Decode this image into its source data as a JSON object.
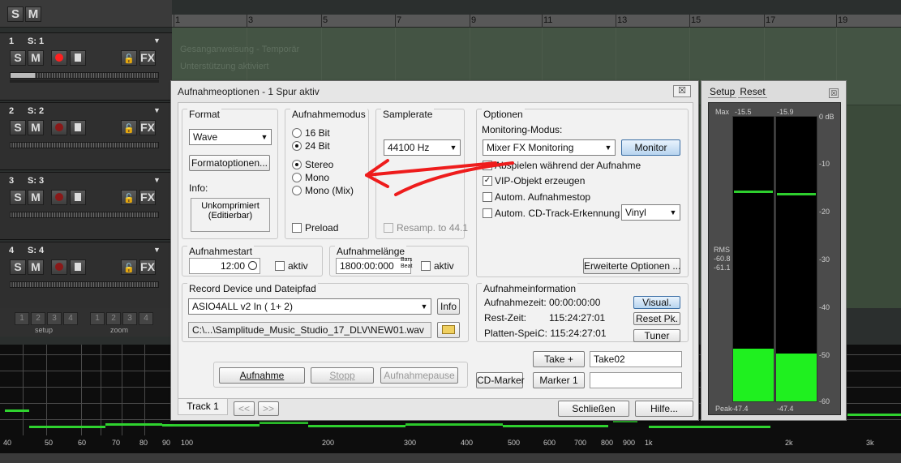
{
  "daw": {
    "top_solo": "S",
    "top_mute": "M",
    "ruler_marks": [
      "1",
      "3",
      "5",
      "7",
      "9",
      "11",
      "13",
      "15",
      "17",
      "19"
    ],
    "faded_lines": [
      "Gesanganweisung - Temporär",
      "Unterstützung aktiviert"
    ],
    "tracks": [
      {
        "num": "1",
        "name": "S: 1",
        "arm": "armed"
      },
      {
        "num": "2",
        "name": "S: 2",
        "arm": "off"
      },
      {
        "num": "3",
        "name": "S: 3",
        "arm": "off"
      },
      {
        "num": "4",
        "name": "S: 4",
        "arm": "off"
      }
    ],
    "track_buttons": {
      "solo": "S",
      "mute": "M",
      "fx": "FX"
    },
    "zoom_numbers": [
      "1",
      "2",
      "3",
      "4"
    ],
    "zoom_labels": {
      "setup": "setup",
      "zoom": "zoom"
    },
    "freq_labels": [
      "40",
      "50",
      "60",
      "70",
      "80",
      "90",
      "100",
      "200",
      "300",
      "400",
      "500",
      "600",
      "700",
      "800",
      "900",
      "1k",
      "2k",
      "3k"
    ]
  },
  "dialog": {
    "title": "Aufnahmeoptionen - 1 Spur aktiv",
    "close": "☒",
    "format": {
      "title": "Format",
      "select": "Wave",
      "options_button": "Formatoptionen...",
      "info_label": "Info:",
      "info_line1": "Unkomprimiert",
      "info_line2": "(Editierbar)"
    },
    "mode": {
      "title": "Aufnahmemodus",
      "bits": [
        "16 Bit",
        "24 Bit"
      ],
      "bits_selected": "24 Bit",
      "channels": [
        "Stereo",
        "Mono",
        "Mono (Mix)"
      ],
      "channels_selected": "Stereo",
      "preload": "Preload"
    },
    "samplerate": {
      "title": "Samplerate",
      "select": "44100 Hz",
      "resamp": "Resamp. to 44.1"
    },
    "options": {
      "title": "Optionen",
      "monitoring_label": "Monitoring-Modus:",
      "monitoring_select": "Mixer FX Monitoring",
      "monitor_button": "Monitor",
      "cb_play": "Abspielen während der Aufnahme",
      "cb_vip": "VIP-Objekt erzeugen",
      "cb_autostop": "Autom. Aufnahmestop",
      "cb_cdtrack": "Autom. CD-Track-Erkennung",
      "vinyl_select": "Vinyl",
      "advanced_button": "Erweiterte Optionen ..."
    },
    "start": {
      "title": "Aufnahmestart",
      "value": "12:00",
      "aktiv": "aktiv"
    },
    "length": {
      "title": "Aufnahmelänge",
      "value": "1800:00:000",
      "unit1": "Bars",
      "unit2": "Beat",
      "aktiv": "aktiv"
    },
    "device": {
      "title": "Record Device und Dateipfad",
      "select": "ASIO4ALL v2 In ( 1+ 2)",
      "info_button": "Info",
      "path": "C:\\...\\Samplitude_Music_Studio_17_DLV\\NEW01.wav"
    },
    "recinfo": {
      "title": "Aufnahmeinformation",
      "time_label": "Aufnahmezeit:",
      "time_value": "00:00:00:00",
      "rest_label": "Rest-Zeit:",
      "rest_value": "115:24:27:01",
      "disk_label": "Platten-Spei.",
      "disk_value": "C: 115:24:27:01",
      "visual_button": "Visual.",
      "resetpk_button": "Reset Pk.",
      "tuner_button": "Tuner"
    },
    "transport": {
      "record": "Aufnahme",
      "stop": "Stopp",
      "pause": "Aufnahmepause"
    },
    "take_button": "Take +",
    "take_value": "Take02",
    "cdmarker_button": "CD-Marker",
    "marker_button": "Marker 1",
    "marker_value": "",
    "track_tab": "Track 1",
    "nav_prev": "<<",
    "nav_next": ">>",
    "close_button": "Schließen",
    "help_button": "Hilfe..."
  },
  "meter": {
    "tab_setup": "Setup",
    "tab_reset": "Reset",
    "close": "☒",
    "max_label": "Max",
    "max_left": "-15.5",
    "max_right": "-15.9",
    "rms_label": "RMS",
    "rms_left": "-60.8",
    "rms_right": "-61.1",
    "peak_label": "Peak",
    "peak_left": "-47.4",
    "peak_right": "-47.4",
    "db_scale": [
      "0 dB",
      "-10",
      "-20",
      "-30",
      "-40",
      "-50",
      "-60"
    ],
    "left_level_db": -49,
    "right_level_db": -50,
    "left_hold_db": -15.5,
    "right_hold_db": -15.9
  }
}
